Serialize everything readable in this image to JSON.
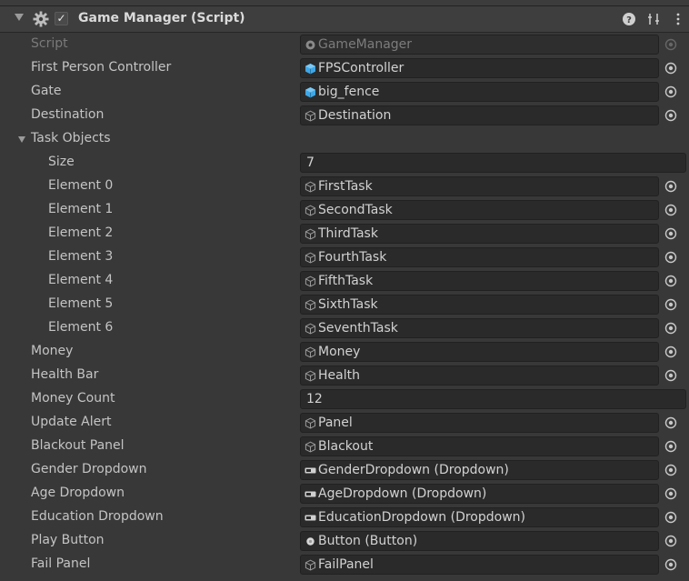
{
  "component": {
    "title": "Game Manager (Script)",
    "enabled": true
  },
  "colors": {
    "background": "#383838",
    "field": "#2a2a2a",
    "prefab_icon": "#3fa7e6",
    "header": "#3e3e3e"
  },
  "rows": [
    {
      "label": "Script",
      "value": "GameManager",
      "icon": "script-icon",
      "dim": true
    },
    {
      "label": "First Person Controller",
      "value": "FPSController",
      "icon": "prefab-cube-icon"
    },
    {
      "label": "Gate",
      "value": "big_fence",
      "icon": "prefab-cube-icon"
    },
    {
      "label": "Destination",
      "value": "Destination",
      "icon": "gameobject-icon"
    },
    {
      "label": "Task Objects",
      "foldout": true
    },
    {
      "label": "Size",
      "value": "7",
      "indent": true,
      "number": true
    },
    {
      "label": "Element 0",
      "value": "FirstTask",
      "icon": "gameobject-icon",
      "indent": true
    },
    {
      "label": "Element 1",
      "value": "SecondTask",
      "icon": "gameobject-icon",
      "indent": true
    },
    {
      "label": "Element 2",
      "value": "ThirdTask",
      "icon": "gameobject-icon",
      "indent": true
    },
    {
      "label": "Element 3",
      "value": "FourthTask",
      "icon": "gameobject-icon",
      "indent": true
    },
    {
      "label": "Element 4",
      "value": "FifthTask",
      "icon": "gameobject-icon",
      "indent": true
    },
    {
      "label": "Element 5",
      "value": "SixthTask",
      "icon": "gameobject-icon",
      "indent": true
    },
    {
      "label": "Element 6",
      "value": "SeventhTask",
      "icon": "gameobject-icon",
      "indent": true
    },
    {
      "label": "Money",
      "value": "Money",
      "icon": "gameobject-icon"
    },
    {
      "label": "Health Bar",
      "value": "Health",
      "icon": "gameobject-icon"
    },
    {
      "label": "Money Count",
      "value": "12",
      "number": true
    },
    {
      "label": "Update Alert",
      "value": "Panel",
      "icon": "gameobject-icon"
    },
    {
      "label": "Blackout Panel",
      "value": "Blackout",
      "icon": "gameobject-icon"
    },
    {
      "label": "Gender Dropdown",
      "value": "GenderDropdown (Dropdown)",
      "icon": "dropdown-icon"
    },
    {
      "label": "Age Dropdown",
      "value": "AgeDropdown (Dropdown)",
      "icon": "dropdown-icon"
    },
    {
      "label": "Education Dropdown",
      "value": "EducationDropdown (Dropdown)",
      "icon": "dropdown-icon"
    },
    {
      "label": "Play Button",
      "value": "Button (Button)",
      "icon": "button-icon"
    },
    {
      "label": "Fail Panel",
      "value": "FailPanel",
      "icon": "gameobject-icon"
    }
  ]
}
